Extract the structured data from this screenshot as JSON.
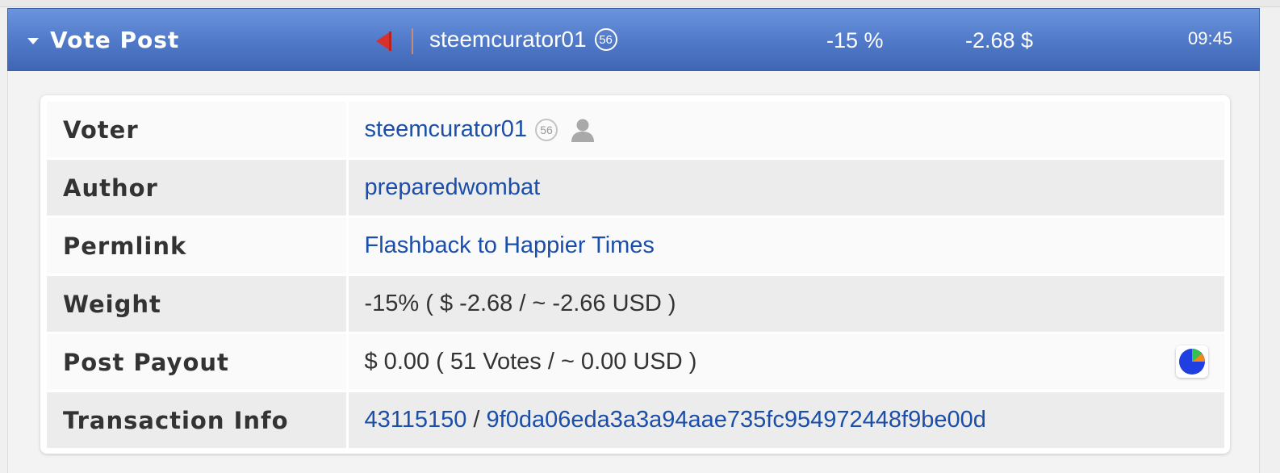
{
  "header": {
    "title": "Vote Post",
    "voter": "steemcurator01",
    "voter_rep": "56",
    "weight_pct": "-15 %",
    "value_usd": "-2.68 $",
    "time": "09:45",
    "flag_color": "#d9302c",
    "flag_icon": "flag-icon"
  },
  "rows": {
    "voter": {
      "label": "Voter",
      "value": "steemcurator01",
      "rep": "56",
      "icon": "user-icon"
    },
    "author": {
      "label": "Author",
      "value": "preparedwombat"
    },
    "permlink": {
      "label": "Permlink",
      "value": "Flashback to Happier Times"
    },
    "weight": {
      "label": "Weight",
      "value": "-15% ( $ -2.68 / ~ -2.66 USD )"
    },
    "payout": {
      "label": "Post Payout",
      "value": "$ 0.00 ( 51 Votes / ~ 0.00 USD )",
      "icon": "pie-chart-icon"
    },
    "tx": {
      "label": "Transaction Info",
      "block": "43115150",
      "separator": " / ",
      "hash": "9f0da06eda3a3a94aae735fc954972448f9be00d"
    }
  },
  "colors": {
    "header_blue": "#4f79c8",
    "link_blue": "#1a4ea8",
    "pie_main": "#1f3fe0",
    "pie_green": "#33c24d",
    "pie_orange": "#f08a1c"
  }
}
